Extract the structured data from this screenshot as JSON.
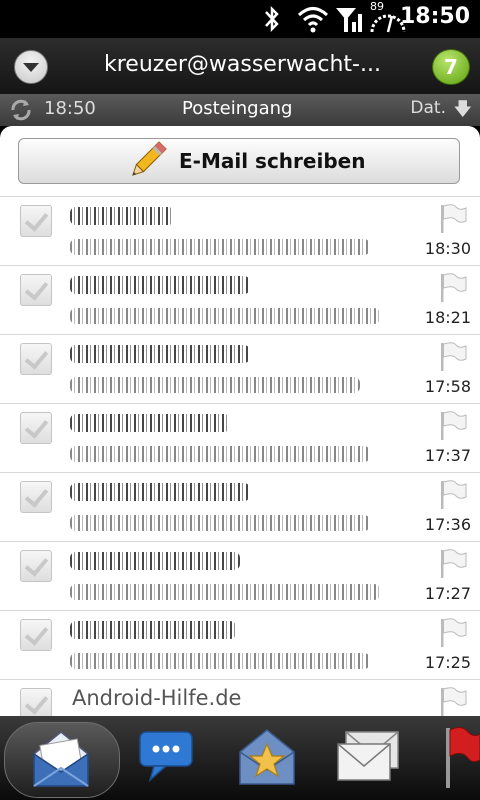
{
  "status_bar": {
    "time": "18:50",
    "battery_percent": "89",
    "icons": [
      "bluetooth-icon",
      "wifi-icon",
      "signal-icon",
      "battery-icon"
    ]
  },
  "account": {
    "name": "kreuzer@wasserwacht-...",
    "unread_count": "7"
  },
  "folder_bar": {
    "sync_time": "18:50",
    "title": "Posteingang",
    "sort_label": "Dat."
  },
  "compose": {
    "label": "E-Mail schreiben"
  },
  "messages": [
    {
      "time": "18:30",
      "sender": ""
    },
    {
      "time": "18:21",
      "sender": ""
    },
    {
      "time": "17:58",
      "sender": ""
    },
    {
      "time": "17:37",
      "sender": ""
    },
    {
      "time": "17:36",
      "sender": ""
    },
    {
      "time": "17:27",
      "sender": ""
    },
    {
      "time": "17:25",
      "sender": ""
    },
    {
      "time": "",
      "sender": "Android-Hilfe.de"
    }
  ],
  "bottom_bar": {
    "items": [
      "inbox-icon",
      "conversations-icon",
      "favorites-icon",
      "all-mail-icon",
      "flagged-icon"
    ]
  },
  "colors": {
    "badge": "#6cb320",
    "list_background": "#ffffff",
    "header_background": "#1e1e1e"
  }
}
